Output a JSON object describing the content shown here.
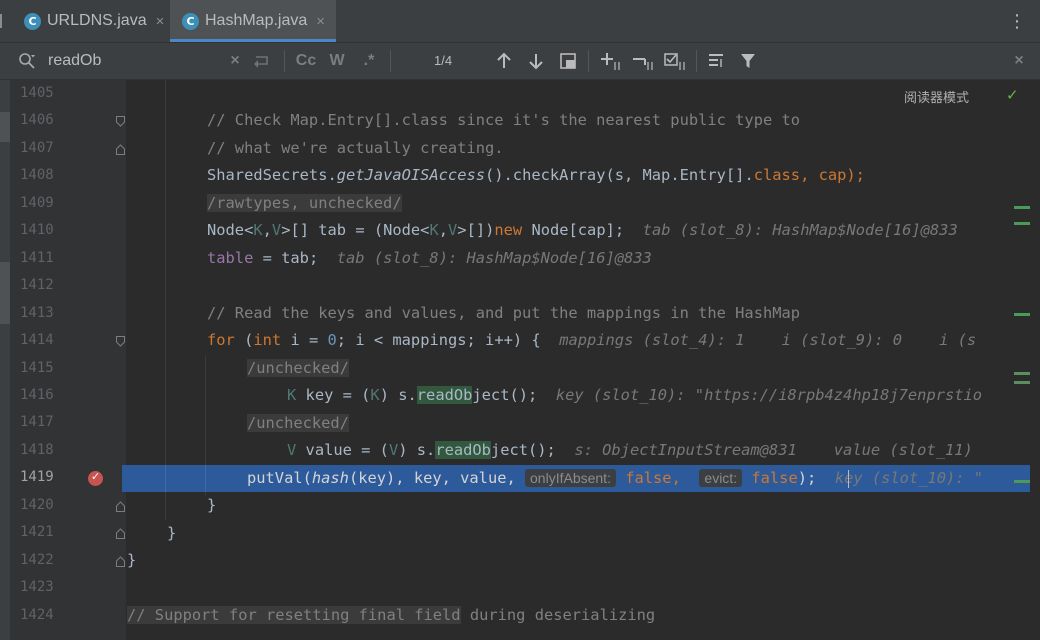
{
  "tabs": [
    {
      "label": "URLDNS.java",
      "icon": "java-class-icon",
      "close": "×",
      "active": false
    },
    {
      "label": "HashMap.java",
      "icon": "java-class-icon",
      "close": "×",
      "active": true
    }
  ],
  "tab_icon_letter": "C",
  "overflow_menu": "⋮",
  "search": {
    "value": "readOb",
    "match_count": "1/4",
    "match_case": "Cc",
    "words": "W",
    "regex": ".*",
    "clear": "×",
    "close": "×"
  },
  "reader_mode": {
    "label": "阅读器模式",
    "check": "✓"
  },
  "line_numbers": [
    "1405",
    "1406",
    "1407",
    "1408",
    "1409",
    "1410",
    "1411",
    "1412",
    "1413",
    "1414",
    "1415",
    "1416",
    "1417",
    "1418",
    "1419",
    "1420",
    "1421",
    "1422",
    "1423",
    "1424"
  ],
  "current_line": "1419",
  "code": {
    "l1406": "// Check Map.Entry[].class since it's the nearest public type to",
    "l1407": "// what we're actually creating.",
    "l1408_a": "SharedSecrets.",
    "l1408_b": "getJavaOISAccess",
    "l1408_c": "().checkArray(s, Map.Entry[].",
    "l1408_d": "class",
    "l1408_e": ", cap);",
    "l1409": "/rawtypes, unchecked/",
    "l1410_a": "Node<",
    "l1410_b": "K",
    "l1410_c": ",",
    "l1410_d": "V",
    "l1410_e": ">[] tab = (Node<",
    "l1410_f": "K",
    "l1410_g": ",",
    "l1410_h": "V",
    "l1410_i": ">[])",
    "l1410_j": "new",
    "l1410_k": " Node[cap];",
    "l1410_hint": "tab (slot_8): HashMap$Node[16]@833",
    "l1411_a": "table",
    "l1411_b": " = tab;",
    "l1411_hint": "tab (slot_8): HashMap$Node[16]@833",
    "l1413": "// Read the keys and values, and put the mappings in the HashMap",
    "l1414_a": "for",
    "l1414_b": " (",
    "l1414_c": "int",
    "l1414_d": " i = ",
    "l1414_e": "0",
    "l1414_f": "; i < mappings; i++) {",
    "l1414_hint": "mappings (slot_4): 1    i (slot_9): 0    i (s",
    "l1415": "/unchecked/",
    "l1416_a": "K",
    "l1416_b": " key = (",
    "l1416_c": "K",
    "l1416_d": ") s.",
    "l1416_e": "readOb",
    "l1416_f": "ject();",
    "l1416_hint": "key (slot_10): \"https://i8rpb4z4hp18j7enprstio",
    "l1417": "/unchecked/",
    "l1418_a": "V",
    "l1418_b": " value = (",
    "l1418_c": "V",
    "l1418_d": ") s.",
    "l1418_e": "readOb",
    "l1418_f": "ject();",
    "l1418_hint": "s: ObjectInputStream@831    value (slot_11)",
    "l1419_a": "putVal(",
    "l1419_b": "hash",
    "l1419_c": "(key), key, value, ",
    "l1419_p1": "onlyIfAbsent:",
    "l1419_d": "false",
    "l1419_e": ", ",
    "l1419_p2": "evict:",
    "l1419_f": "false",
    "l1419_g": ");",
    "l1419_hint": "key (slot_10): \"",
    "l1420": "}",
    "l1421": "}",
    "l1422": "}",
    "l1424_a": "// Support for resetting final field",
    "l1424_b": " during deserializing"
  },
  "colors": {
    "keyword": "#cc7832",
    "comment": "#808080",
    "field": "#9876aa",
    "number": "#6897bb",
    "execution_line": "#2d5a9a",
    "breakpoint": "#c75450",
    "search_match": "#32593d"
  }
}
